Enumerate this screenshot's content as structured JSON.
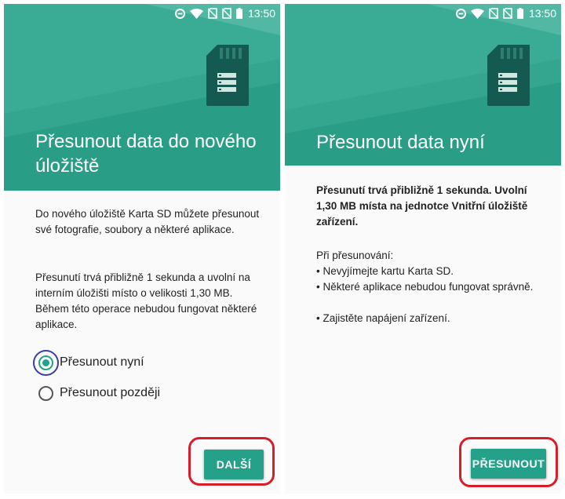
{
  "status_bar": {
    "time": "13:50"
  },
  "left_screen": {
    "title": "Přesunout data do nového úložiště",
    "paragraph_1": "Do nového úložiště Karta SD můžete přesunout své fotografie, soubory a některé aplikace.",
    "paragraph_2": "Přesunutí trvá přibližně 1 sekunda a uvolní na interním úložišti místo o velikosti 1,30 MB. Během této operace nebudou fungovat některé aplikace.",
    "options": [
      {
        "label": "Přesunout nyní",
        "selected": true
      },
      {
        "label": "Přesunout později",
        "selected": false
      }
    ],
    "next_button": "DALŠÍ"
  },
  "right_screen": {
    "title": "Přesunout data nyní",
    "summary": "Přesunutí trvá přibližně 1 sekunda. Uvolní 1,30 MB místa na jednotce Vnitřní úložiště zařízení.",
    "during_heading": "Při přesunování:",
    "bullets": [
      "• Nevyjímejte kartu Karta SD.",
      "• Některé aplikace nebudou fungovat správně.",
      "• Zajistěte napájení zařízení."
    ],
    "move_button": "PŘESUNOUT"
  },
  "colors": {
    "accent": "#26a189",
    "hero": "#2a9d87",
    "annotation_red": "#d71e28",
    "annotation_blue": "#3b3ba8"
  },
  "icons": [
    "dnd-icon",
    "wifi-icon",
    "no-sim-icon",
    "no-sim-icon",
    "battery-icon",
    "sd-card-icon",
    "radio-button"
  ]
}
